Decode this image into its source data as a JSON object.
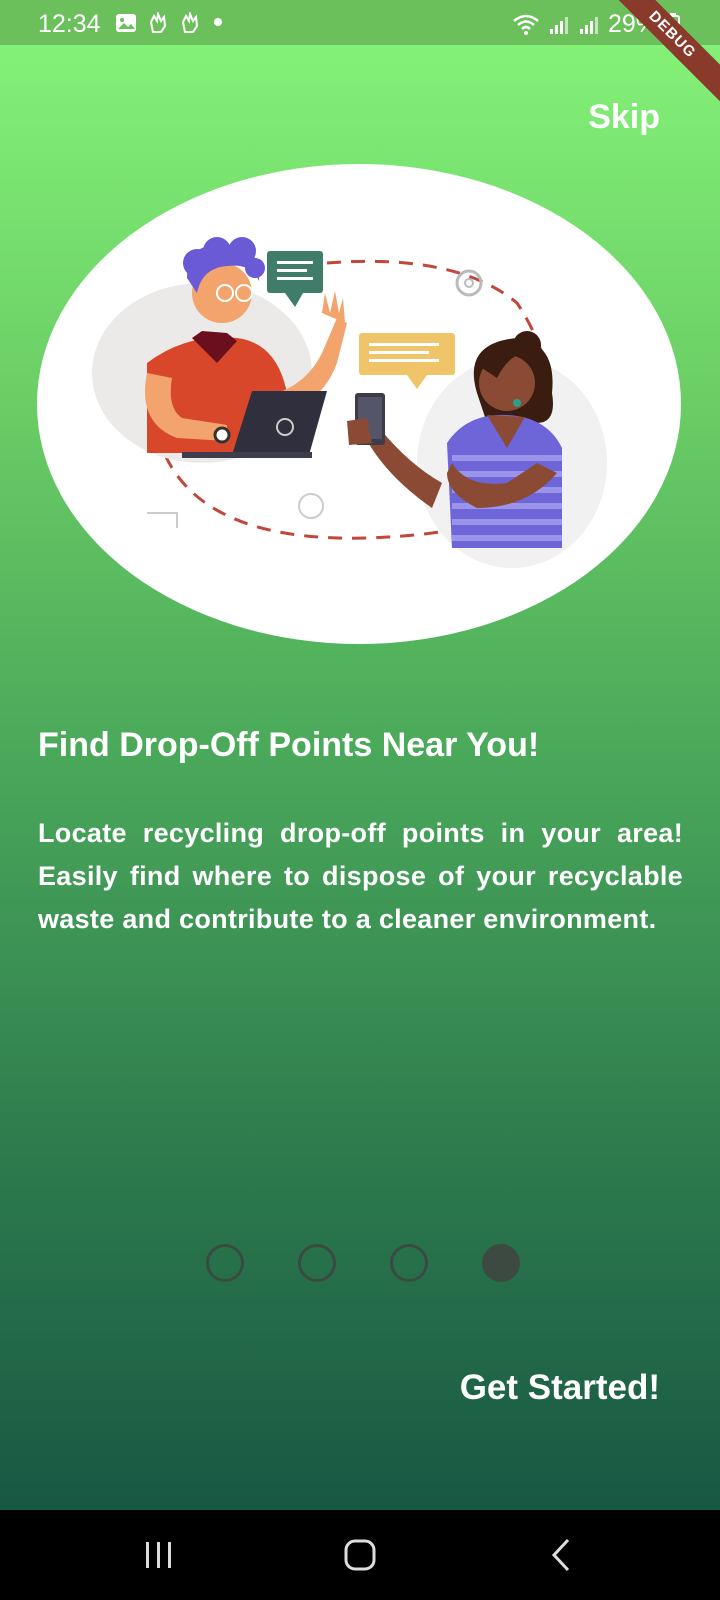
{
  "status_bar": {
    "time": "12:34",
    "battery": "29%",
    "icons": [
      "image-icon",
      "hand-icon",
      "hand-icon",
      "wifi-icon",
      "signal-icon",
      "signal-icon",
      "battery-icon"
    ]
  },
  "debug_banner": "DEBUG",
  "onboarding": {
    "skip_label": "Skip",
    "title": "Find Drop-Off Points Near You!",
    "description": "Locate recycling drop-off points in your area! Easily find where to dispose of your recyclable waste and contribute to a cleaner environment.",
    "page_count": 4,
    "active_page": 4,
    "cta_label": "Get Started!"
  },
  "colors": {
    "gradient_top": "#86f57a",
    "gradient_bottom": "#175843",
    "dot_color": "#3d4a42"
  },
  "nav": {
    "buttons": [
      "recents-icon",
      "home-icon",
      "back-icon"
    ]
  }
}
